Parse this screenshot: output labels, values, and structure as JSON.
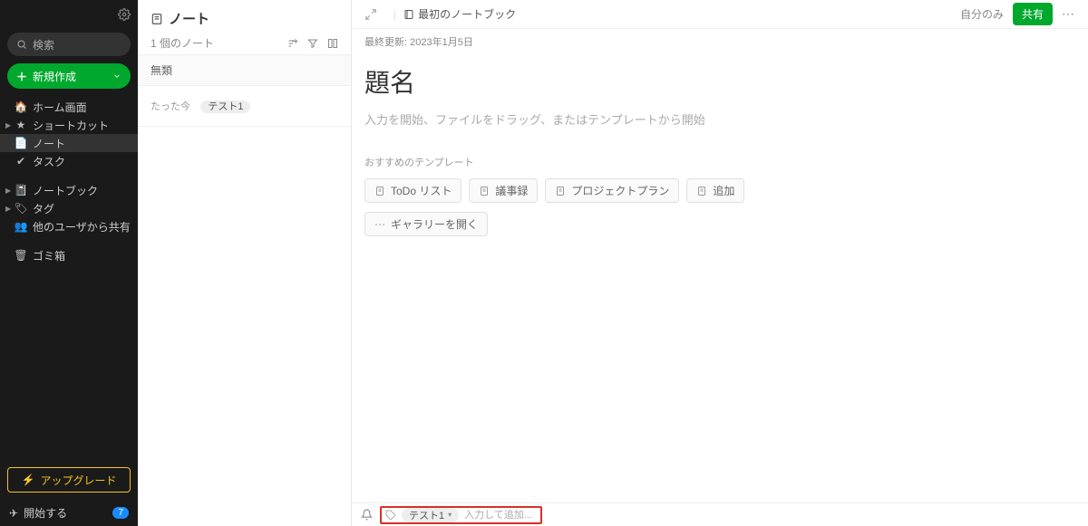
{
  "sidebar": {
    "search_placeholder": "検索",
    "new_label": "新規作成",
    "items": {
      "home": "ホーム画面",
      "shortcuts": "ショートカット",
      "notes": "ノート",
      "tasks": "タスク",
      "notebooks": "ノートブック",
      "tags": "タグ",
      "shared": "他のユーザから共有",
      "trash": "ゴミ箱"
    },
    "upgrade": "アップグレード",
    "start": "開始する",
    "start_badge": "7"
  },
  "notelist": {
    "title": "ノート",
    "count": "1 個のノート",
    "group": "無類",
    "item": {
      "when": "たった今",
      "tag": "テスト1"
    }
  },
  "editor": {
    "notebook": "最初のノートブック",
    "only_me": "自分のみ",
    "share": "共有",
    "updated_prefix": "最終更新:",
    "updated_value": "2023年1月5日",
    "title": "題名",
    "placeholder": "入力を開始、ファイルをドラッグ、またはテンプレートから開始",
    "templates_label": "おすすめのテンプレート",
    "templates": {
      "todo": "ToDo リスト",
      "meeting": "議事録",
      "project": "プロジェクトプラン",
      "add": "追加",
      "gallery": "ギャラリーを開く"
    },
    "footer": {
      "tag": "テスト1",
      "input_placeholder": "入力して追加..."
    }
  }
}
